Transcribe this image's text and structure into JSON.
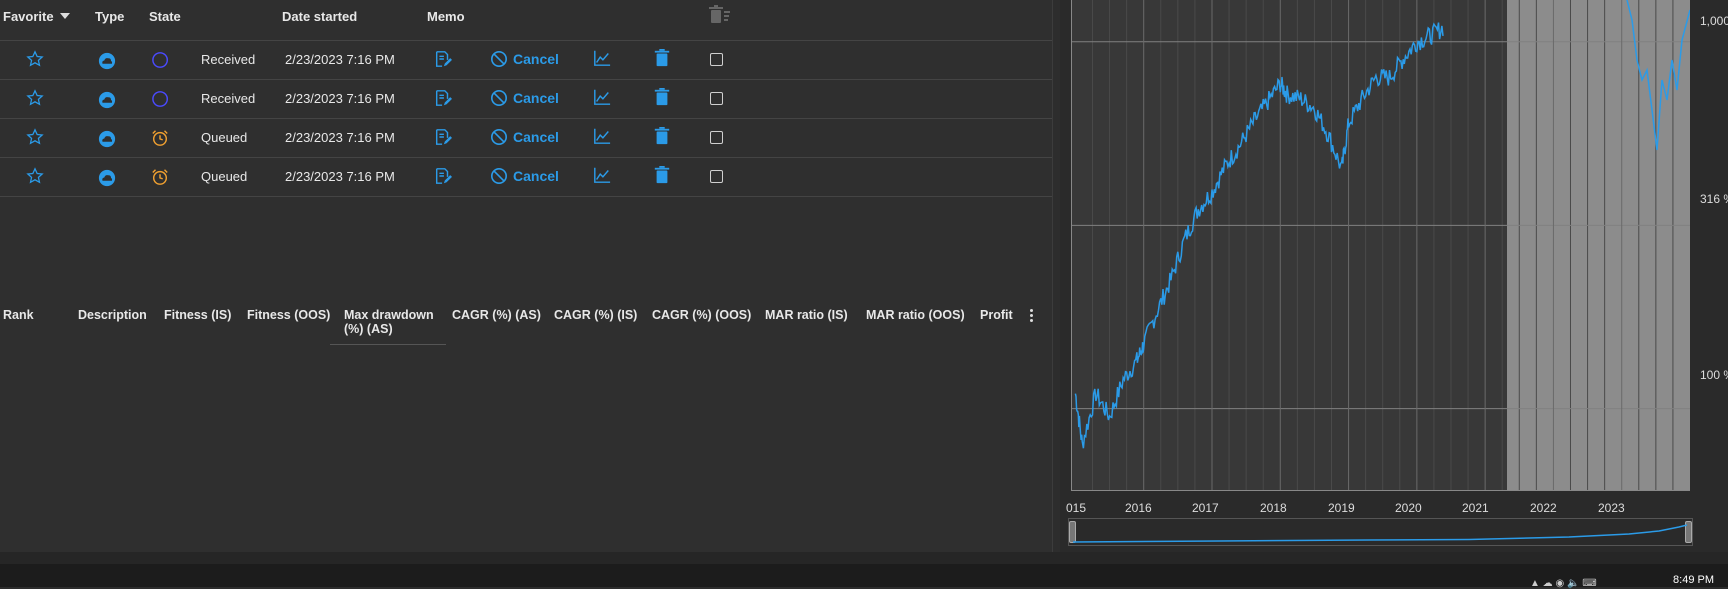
{
  "colors": {
    "accent": "#2b9be8",
    "queued": "#f0a030",
    "received": "#4a4aff"
  },
  "runs_table": {
    "headers": {
      "favorite": "Favorite",
      "type": "Type",
      "state": "State",
      "date_started": "Date started",
      "memo": "Memo"
    },
    "rows": [
      {
        "state": "Received",
        "date": "2/23/2023 7:16 PM",
        "cancel": "Cancel"
      },
      {
        "state": "Received",
        "date": "2/23/2023 7:16 PM",
        "cancel": "Cancel"
      },
      {
        "state": "Queued",
        "date": "2/23/2023 7:16 PM",
        "cancel": "Cancel"
      },
      {
        "state": "Queued",
        "date": "2/23/2023 7:16 PM",
        "cancel": "Cancel"
      }
    ]
  },
  "results_table": {
    "headers": [
      "Rank",
      "Description",
      "Fitness (IS)",
      "Fitness (OOS)",
      "Max drawdown",
      "(%) (AS)",
      "CAGR (%) (AS)",
      "CAGR (%) (IS)",
      "CAGR (%) (OOS)",
      "MAR ratio (IS)",
      "MAR ratio (OOS)",
      "Profit f"
    ]
  },
  "chart": {
    "y_labels": [
      "1,000",
      "316 %",
      "100 %"
    ],
    "x_labels": [
      "015",
      "2016",
      "2017",
      "2018",
      "2019",
      "2020",
      "2021",
      "2022",
      "2023"
    ]
  },
  "chart_data": {
    "type": "line",
    "x": [
      2015.0,
      2015.1,
      2015.3,
      2015.5,
      2015.7,
      2015.9,
      2016.0,
      2016.2,
      2016.4,
      2016.6,
      2016.8,
      2017.0,
      2017.2,
      2017.4,
      2017.6,
      2017.8,
      2018.0,
      2018.1,
      2018.3,
      2018.5,
      2018.7,
      2018.9,
      2019.0,
      2019.2,
      2019.4,
      2019.6,
      2019.8,
      2020.0,
      2020.2,
      2020.4
    ],
    "y": [
      110,
      80,
      110,
      95,
      120,
      135,
      150,
      185,
      225,
      290,
      350,
      390,
      460,
      520,
      600,
      680,
      770,
      720,
      700,
      660,
      560,
      450,
      600,
      700,
      800,
      800,
      900,
      1000,
      1040,
      1100
    ],
    "ylim": [
      60,
      1300
    ],
    "xlim": [
      2014.95,
      2024.0
    ],
    "y_scale": "log",
    "shaded_range": [
      2020.4,
      2024.0
    ]
  },
  "taskbar": {
    "time": "8:49 PM"
  }
}
